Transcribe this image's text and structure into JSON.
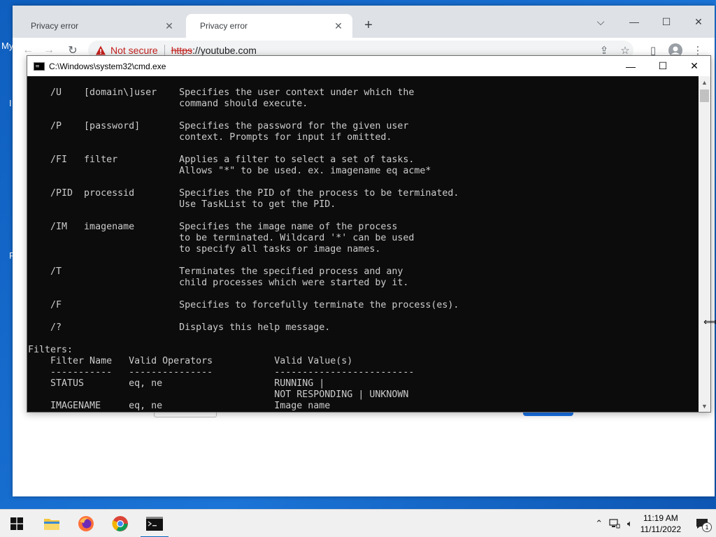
{
  "desktop": {
    "fragment_my": "My",
    "fragment_i": "I",
    "fragment_r": "R"
  },
  "browser": {
    "tabs": [
      {
        "title": "Privacy error",
        "active": false
      },
      {
        "title": "Privacy error",
        "active": true
      }
    ],
    "new_tab_symbol": "+",
    "omnibox": {
      "security_label": "Not secure",
      "url_scheme": "https",
      "url_rest": "://youtube.com"
    }
  },
  "cmd": {
    "title": "C:\\Windows\\system32\\cmd.exe",
    "lines": [
      "    /U    [domain\\]user    Specifies the user context under which the",
      "                           command should execute.",
      "",
      "    /P    [password]       Specifies the password for the given user",
      "                           context. Prompts for input if omitted.",
      "",
      "    /FI   filter           Applies a filter to select a set of tasks.",
      "                           Allows \"*\" to be used. ex. imagename eq acme*",
      "",
      "    /PID  processid        Specifies the PID of the process to be terminated.",
      "                           Use TaskList to get the PID.",
      "",
      "    /IM   imagename        Specifies the image name of the process",
      "                           to be terminated. Wildcard '*' can be used",
      "                           to specify all tasks or image names.",
      "",
      "    /T                     Terminates the specified process and any",
      "                           child processes which were started by it.",
      "",
      "    /F                     Specifies to forcefully terminate the process(es).",
      "",
      "    /?                     Displays this help message.",
      "",
      "Filters:",
      "    Filter Name   Valid Operators           Valid Value(s)",
      "    -----------   ---------------           -------------------------",
      "    STATUS        eq, ne                    RUNNING |",
      "                                            NOT RESPONDING | UNKNOWN",
      "    IMAGENAME     eq, ne                    Image name"
    ]
  },
  "taskbar": {
    "apps": [
      {
        "name": "start",
        "active": false
      },
      {
        "name": "file-explorer",
        "active": false
      },
      {
        "name": "firefox",
        "active": false
      },
      {
        "name": "chrome",
        "active": false
      },
      {
        "name": "cmd",
        "active": true
      }
    ],
    "clock": {
      "time": "11:19 AM",
      "date": "11/11/2022"
    },
    "notification_count": "1"
  },
  "colors": {
    "desktop_blue": "#1766c8",
    "not_secure_red": "#c5221f",
    "console_bg": "#0c0c0c",
    "console_text": "#cccccc"
  }
}
